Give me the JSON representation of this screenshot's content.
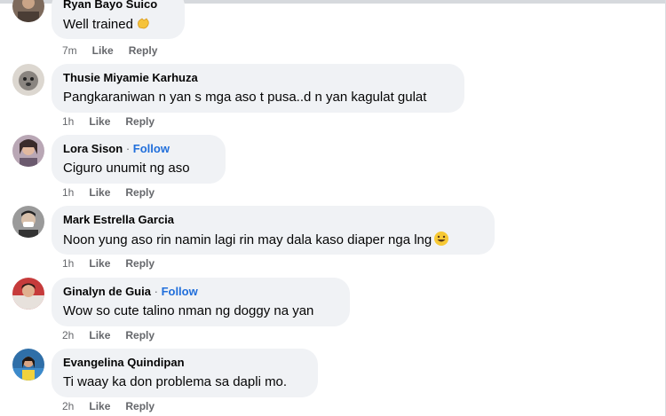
{
  "actions": {
    "like": "Like",
    "reply": "Reply",
    "follow": "Follow",
    "separator": "·"
  },
  "comments": [
    {
      "author": "Ryan Bayo Suico",
      "text": "Well trained",
      "emoji": "clapping-hands-icon",
      "time": "7m",
      "has_follow": false
    },
    {
      "author": "Thusie Miyamie Karhuza",
      "text": "Pangkaraniwan n yan s mga aso t pusa..d n yan kagulat gulat",
      "time": "1h",
      "has_follow": false
    },
    {
      "author": "Lora Sison",
      "text": "Ciguro unumit ng aso",
      "time": "1h",
      "has_follow": true
    },
    {
      "author": "Mark Estrella Garcia",
      "text": "Noon yung aso rin namin lagi rin may dala kaso diaper nga lng",
      "emoji": "grinning-face-icon",
      "time": "1h",
      "has_follow": false
    },
    {
      "author": "Ginalyn de Guia",
      "text": "Wow so cute talino nman ng doggy na yan",
      "time": "2h",
      "has_follow": true
    },
    {
      "author": "Evangelina Quindipan",
      "text": "Ti waay ka don problema sa dapli mo.",
      "time": "2h",
      "has_follow": false
    }
  ]
}
